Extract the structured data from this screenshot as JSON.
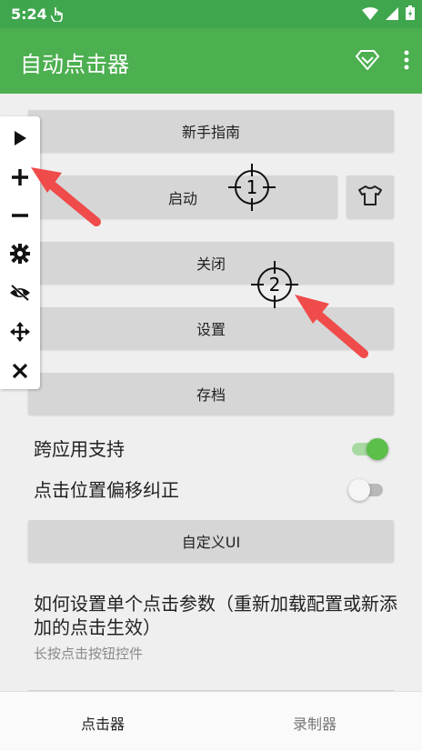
{
  "status": {
    "time": "5:24"
  },
  "appbar": {
    "title": "自动点击器"
  },
  "buttons": {
    "guide": "新手指南",
    "start": "启动",
    "close": "关闭",
    "settings": "设置",
    "save": "存档",
    "custom_ui": "自定义UI"
  },
  "toggles": [
    {
      "label": "跨应用支持",
      "on": true
    },
    {
      "label": "点击位置偏移纠正",
      "on": false
    }
  ],
  "help": {
    "title": "如何设置单个点击参数（重新加载配置或新添加的点击生效）",
    "subtitle": "长按点击按钮控件"
  },
  "bottom_nav": {
    "clicker": "点击器",
    "recorder": "录制器"
  },
  "targets": [
    {
      "label": "1"
    },
    {
      "label": "2"
    }
  ],
  "colors": {
    "primary": "#4caf50",
    "status": "#3fa64e",
    "arrow": "#f04b4b",
    "switch_on": "#5bbf4a"
  }
}
